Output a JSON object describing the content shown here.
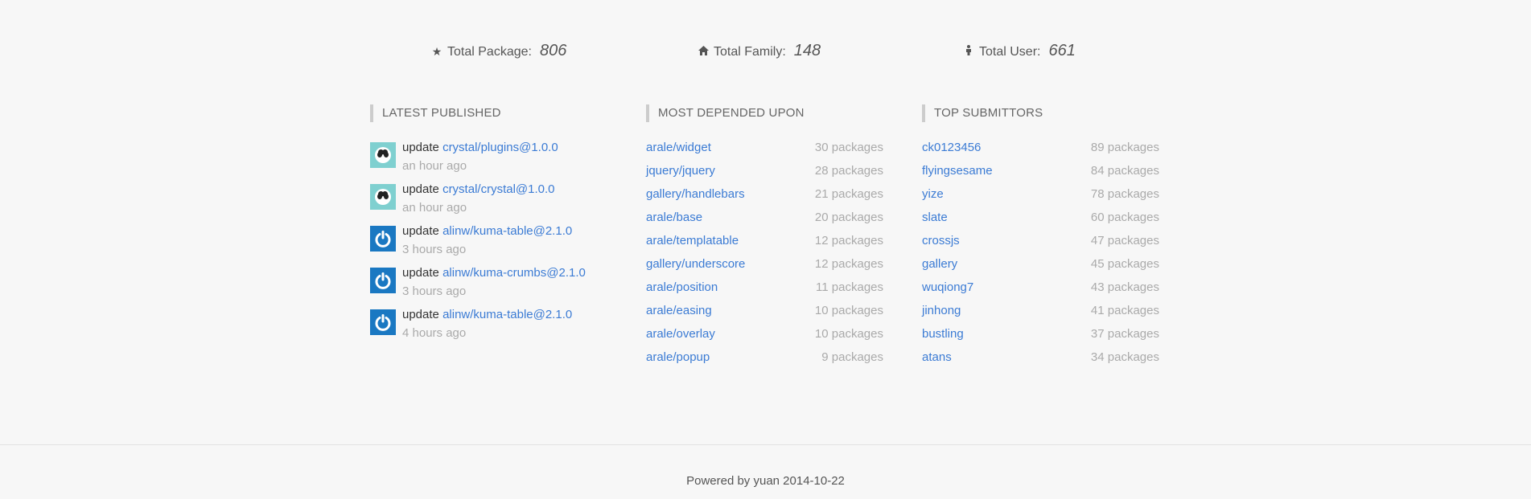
{
  "stats": [
    {
      "icon": "star-icon",
      "label": "Total Package:",
      "value": "806"
    },
    {
      "icon": "home-icon",
      "label": "Total Family:",
      "value": "148"
    },
    {
      "icon": "user-icon",
      "label": "Total User:",
      "value": "661"
    }
  ],
  "latest": {
    "heading": "LATEST PUBLISHED",
    "items": [
      {
        "avatar": "panda-avatar",
        "action": "update",
        "package": "crystal/plugins@1.0.0",
        "time": "an hour ago"
      },
      {
        "avatar": "panda-avatar",
        "action": "update",
        "package": "crystal/crystal@1.0.0",
        "time": "an hour ago"
      },
      {
        "avatar": "power-avatar",
        "action": "update",
        "package": "alinw/kuma-table@2.1.0",
        "time": "3 hours ago"
      },
      {
        "avatar": "power-avatar",
        "action": "update",
        "package": "alinw/kuma-crumbs@2.1.0",
        "time": "3 hours ago"
      },
      {
        "avatar": "power-avatar",
        "action": "update",
        "package": "alinw/kuma-table@2.1.0",
        "time": "4 hours ago"
      }
    ]
  },
  "depended": {
    "heading": "MOST DEPENDED UPON",
    "items": [
      {
        "name": "arale/widget",
        "count": "30 packages"
      },
      {
        "name": "jquery/jquery",
        "count": "28 packages"
      },
      {
        "name": "gallery/handlebars",
        "count": "21 packages"
      },
      {
        "name": "arale/base",
        "count": "20 packages"
      },
      {
        "name": "arale/templatable",
        "count": "12 packages"
      },
      {
        "name": "gallery/underscore",
        "count": "12 packages"
      },
      {
        "name": "arale/position",
        "count": "11 packages"
      },
      {
        "name": "arale/easing",
        "count": "10 packages"
      },
      {
        "name": "arale/overlay",
        "count": "10 packages"
      },
      {
        "name": "arale/popup",
        "count": "9 packages"
      }
    ]
  },
  "submitters": {
    "heading": "TOP SUBMITTORS",
    "items": [
      {
        "name": "ck0123456",
        "count": "89 packages"
      },
      {
        "name": "flyingsesame",
        "count": "84 packages"
      },
      {
        "name": "yize",
        "count": "78 packages"
      },
      {
        "name": "slate",
        "count": "60 packages"
      },
      {
        "name": "crossjs",
        "count": "47 packages"
      },
      {
        "name": "gallery",
        "count": "45 packages"
      },
      {
        "name": "wuqiong7",
        "count": "43 packages"
      },
      {
        "name": "jinhong",
        "count": "41 packages"
      },
      {
        "name": "bustling",
        "count": "37 packages"
      },
      {
        "name": "atans",
        "count": "34 packages"
      }
    ]
  },
  "footer": {
    "text": "Powered by yuan 2014-10-22"
  },
  "colors": {
    "link": "#3b7bd4",
    "muted": "#aaaaaa",
    "background": "#f7f7f7"
  }
}
